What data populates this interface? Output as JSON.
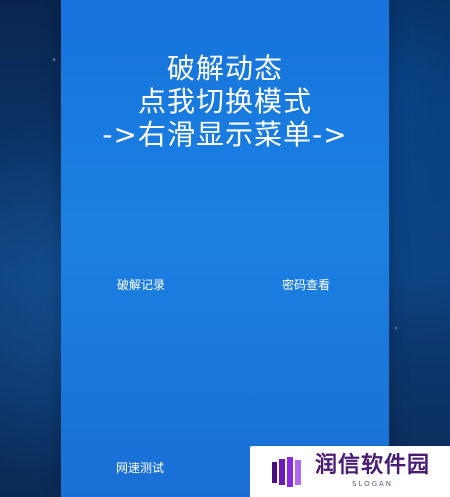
{
  "header": {
    "lines": [
      "破解动态",
      "点我切换模式",
      "->右滑显示菜单->"
    ]
  },
  "menu": {
    "items": [
      {
        "label": "破解记录"
      },
      {
        "label": "密码查看"
      },
      {
        "label": "网速测试"
      }
    ]
  },
  "watermark": {
    "brand": "润信软件园",
    "slogan": "SLOGAN"
  },
  "colors": {
    "panel_blue": "#1b80e2",
    "background_navy": "#0b2f63",
    "text_white": "#ffffff",
    "watermark_purple": "#4a1b73"
  }
}
